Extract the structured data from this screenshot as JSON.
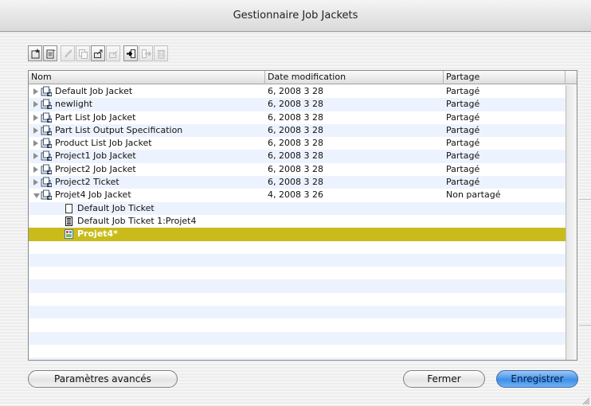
{
  "window": {
    "title": "Gestionnaire Job Jackets"
  },
  "toolbar": {
    "buttons": [
      {
        "icon": "new-jacket-icon"
      },
      {
        "icon": "new-ticket-icon"
      },
      {
        "icon": "edit-pencil-icon"
      },
      {
        "icon": "duplicate-icon"
      },
      {
        "icon": "link-icon"
      },
      {
        "icon": "unlink-icon"
      },
      {
        "icon": "import-icon"
      },
      {
        "icon": "export-icon"
      },
      {
        "icon": "delete-icon"
      }
    ]
  },
  "table": {
    "columns": [
      "Nom",
      "Date modification",
      "Partage"
    ],
    "rows": [
      {
        "name": "Default Job Jacket",
        "date": "6, 2008 3 28",
        "share": "Partagé",
        "level": 0,
        "expander": "right",
        "icon": "jacket-icon"
      },
      {
        "name": "newlight",
        "date": "6, 2008 3 28",
        "share": "Partagé",
        "level": 0,
        "expander": "right",
        "icon": "jacket-icon"
      },
      {
        "name": "Part List Job Jacket",
        "date": "6, 2008 3 28",
        "share": "Partagé",
        "level": 0,
        "expander": "right",
        "icon": "jacket-icon"
      },
      {
        "name": "Part List Output Specification",
        "date": "6, 2008 3 28",
        "share": "Partagé",
        "level": 0,
        "expander": "right",
        "icon": "jacket-icon"
      },
      {
        "name": "Product List Job Jacket",
        "date": "6, 2008 3 28",
        "share": "Partagé",
        "level": 0,
        "expander": "right",
        "icon": "jacket-icon"
      },
      {
        "name": "Project1 Job Jacket",
        "date": "6, 2008 3 28",
        "share": "Partagé",
        "level": 0,
        "expander": "right",
        "icon": "jacket-icon"
      },
      {
        "name": "Project2 Job Jacket",
        "date": "6, 2008 3 28",
        "share": "Partagé",
        "level": 0,
        "expander": "right",
        "icon": "jacket-icon"
      },
      {
        "name": "Project2 Ticket",
        "date": "6, 2008 3 28",
        "share": "Partagé",
        "level": 0,
        "expander": "right",
        "icon": "jacket-icon"
      },
      {
        "name": "Projet4 Job Jacket",
        "date": "4, 2008 3 26",
        "share": "Non partagé",
        "level": 0,
        "expander": "down",
        "icon": "jacket-icon"
      },
      {
        "name": "Default Job Ticket",
        "date": "",
        "share": "",
        "level": 1,
        "expander": "",
        "icon": "ticket-template-icon"
      },
      {
        "name": "Default Job Ticket 1:Projet4",
        "date": "",
        "share": "",
        "level": 1,
        "expander": "",
        "icon": "ticket-icon"
      },
      {
        "name": "Projet4*",
        "date": "",
        "share": "",
        "level": 1,
        "expander": "",
        "icon": "layout-icon",
        "selected": true
      }
    ],
    "empty_rows": 10
  },
  "buttons": {
    "advanced": "Paramètres avancés",
    "close": "Fermer",
    "save": "Enregistrer"
  }
}
